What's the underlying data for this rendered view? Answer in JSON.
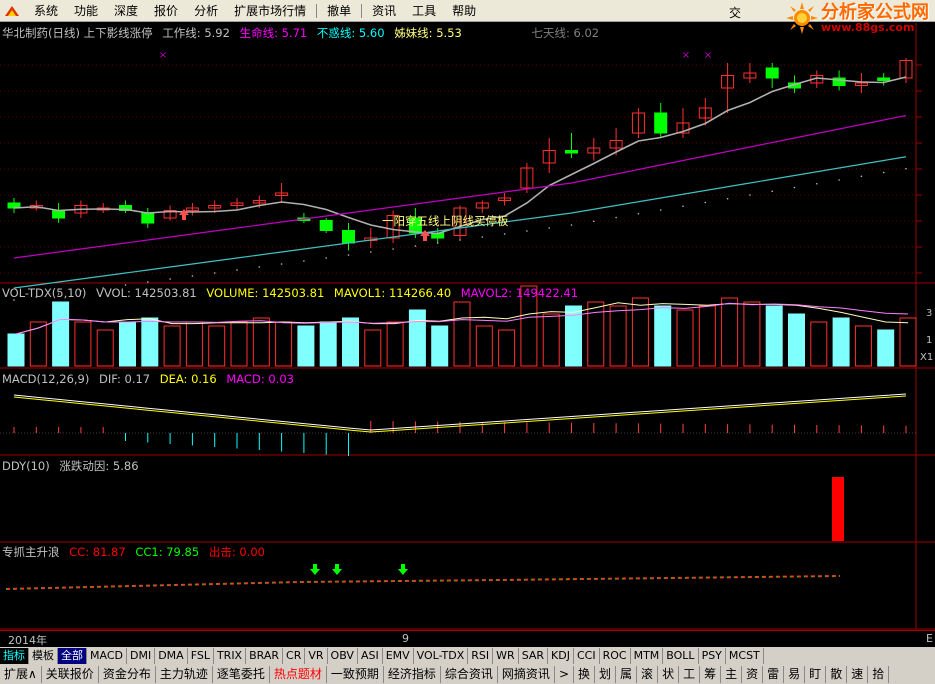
{
  "menu": {
    "items": [
      "系统",
      "功能",
      "深度",
      "报价",
      "分析",
      "扩展市场行情",
      "撤单",
      "资讯",
      "工具",
      "帮助"
    ],
    "trade_label": "交易"
  },
  "brand": {
    "name": "分析家公式网",
    "url": "www.88gs.com"
  },
  "main_panel": {
    "title": "华北制药(日线) 上下影线涨停",
    "lines": [
      {
        "label": "工作线: 5.92",
        "color": "#c0c0c0"
      },
      {
        "label": "生命线: 5.71",
        "color": "#ff00ff"
      },
      {
        "label": "不惑线: 5.60",
        "color": "#00ffff"
      },
      {
        "label": "姊妹线: 5.53",
        "color": "#ffff80"
      },
      {
        "label": "七天线: 6.02",
        "color": "#808080"
      }
    ],
    "annotation": "一阳穿五线上阴线买停板"
  },
  "vol_panel": {
    "title": "VOL-TDX(5,10)",
    "values": [
      {
        "label": "VVOL: 142503.81",
        "color": "#c0c0c0"
      },
      {
        "label": "VOLUME: 142503.81",
        "color": "#ffff00"
      },
      {
        "label": "MAVOL1: 114266.40",
        "color": "#ffff00"
      },
      {
        "label": "MAVOL2: 149422.41",
        "color": "#ff00ff"
      }
    ],
    "right_tags": [
      "3",
      "1",
      "X1"
    ]
  },
  "macd_panel": {
    "title": "MACD(12,26,9)",
    "values": [
      {
        "label": "DIF: 0.17",
        "color": "#c0c0c0"
      },
      {
        "label": "DEA: 0.16",
        "color": "#ffff00"
      },
      {
        "label": "MACD: 0.03",
        "color": "#ff00ff"
      }
    ]
  },
  "ddy_panel": {
    "title": "DDY(10)",
    "values": [
      {
        "label": "涨跌动因: 5.86",
        "color": "#c0c0c0"
      }
    ]
  },
  "zz_panel": {
    "title": "专抓主升浪",
    "values": [
      {
        "label": "CC: 81.87",
        "color": "#ff0000"
      },
      {
        "label": "CC1: 79.85",
        "color": "#00ff00"
      },
      {
        "label": "出击: 0.00",
        "color": "#ff0000"
      }
    ]
  },
  "date_axis": {
    "labels": [
      "2014年",
      "9"
    ],
    "right_label": "E"
  },
  "tabs": [
    "指标",
    "模板",
    "全部",
    "MACD",
    "DMI",
    "DMA",
    "FSL",
    "TRIX",
    "BRAR",
    "CR",
    "VR",
    "OBV",
    "ASI",
    "EMV",
    "VOL-TDX",
    "RSI",
    "WR",
    "SAR",
    "KDJ",
    "CCI",
    "ROC",
    "MTM",
    "BOLL",
    "PSY",
    "MCST"
  ],
  "bottom_buttons": [
    "扩展∧",
    "关联报价",
    "资金分布",
    "主力轨迹",
    "逐笔委托",
    "热点题材",
    "一致预期",
    "经济指标",
    "综合资讯",
    "网摘资讯",
    ">",
    "换",
    "划",
    "属",
    "滚",
    "状",
    "工",
    "筹",
    "主",
    "资",
    "雷",
    "易",
    "盯",
    "散",
    "速",
    "拾"
  ],
  "colors": {
    "up": "#ff3030",
    "down": "#00ff00",
    "cyan_bar": "#80ffff",
    "grid": "#800000"
  }
}
